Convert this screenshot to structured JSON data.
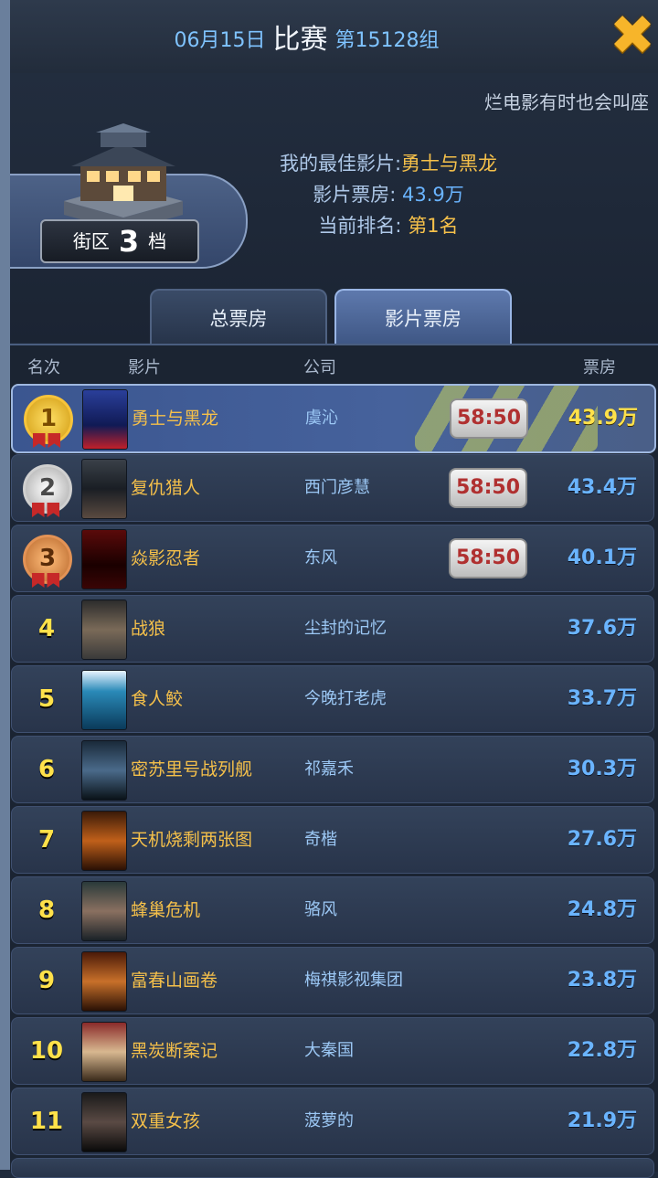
{
  "header": {
    "date": "06月15日",
    "match": "比赛",
    "group": "第15128组",
    "close_icon": "close-x-icon"
  },
  "ticker": "烂电影有时也会叫座",
  "district": {
    "prefix": "街区",
    "level": "3",
    "suffix": "档"
  },
  "info": {
    "best_label": "我的最佳影片:",
    "best_value": "勇士与黑龙",
    "box_label": "影片票房:",
    "box_value": "43.9万",
    "rank_label": "当前排名:",
    "rank_value": "第1名"
  },
  "tabs": [
    {
      "label": "总票房",
      "active": false
    },
    {
      "label": "影片票房",
      "active": true
    }
  ],
  "columns": {
    "rank": "名次",
    "movie": "影片",
    "company": "公司",
    "box": "票房"
  },
  "rows": [
    {
      "rank": "1",
      "movie": "勇士与黑龙",
      "company": "虞沁",
      "badge": "58:50",
      "box": "43.9万"
    },
    {
      "rank": "2",
      "movie": "复仇猎人",
      "company": "西门彦慧",
      "badge": "58:50",
      "box": "43.4万"
    },
    {
      "rank": "3",
      "movie": "焱影忍者",
      "company": "东风",
      "badge": "58:50",
      "box": "40.1万"
    },
    {
      "rank": "4",
      "movie": "战狼",
      "company": "尘封的记忆",
      "box": "37.6万"
    },
    {
      "rank": "5",
      "movie": "食人鲛",
      "company": "今晚打老虎",
      "box": "33.7万"
    },
    {
      "rank": "6",
      "movie": "密苏里号战列舰",
      "company": "祁嘉禾",
      "box": "30.3万"
    },
    {
      "rank": "7",
      "movie": "天机烧剩两张图",
      "company": "奇楷",
      "box": "27.6万"
    },
    {
      "rank": "8",
      "movie": "蜂巢危机",
      "company": "骆风",
      "box": "24.8万"
    },
    {
      "rank": "9",
      "movie": "富春山画卷",
      "company": "梅祺影视集团",
      "box": "23.8万"
    },
    {
      "rank": "10",
      "movie": "黑炭断案记",
      "company": "大秦国",
      "box": "22.8万"
    },
    {
      "rank": "11",
      "movie": "双重女孩",
      "company": "菠萝的",
      "box": "21.9万"
    }
  ]
}
